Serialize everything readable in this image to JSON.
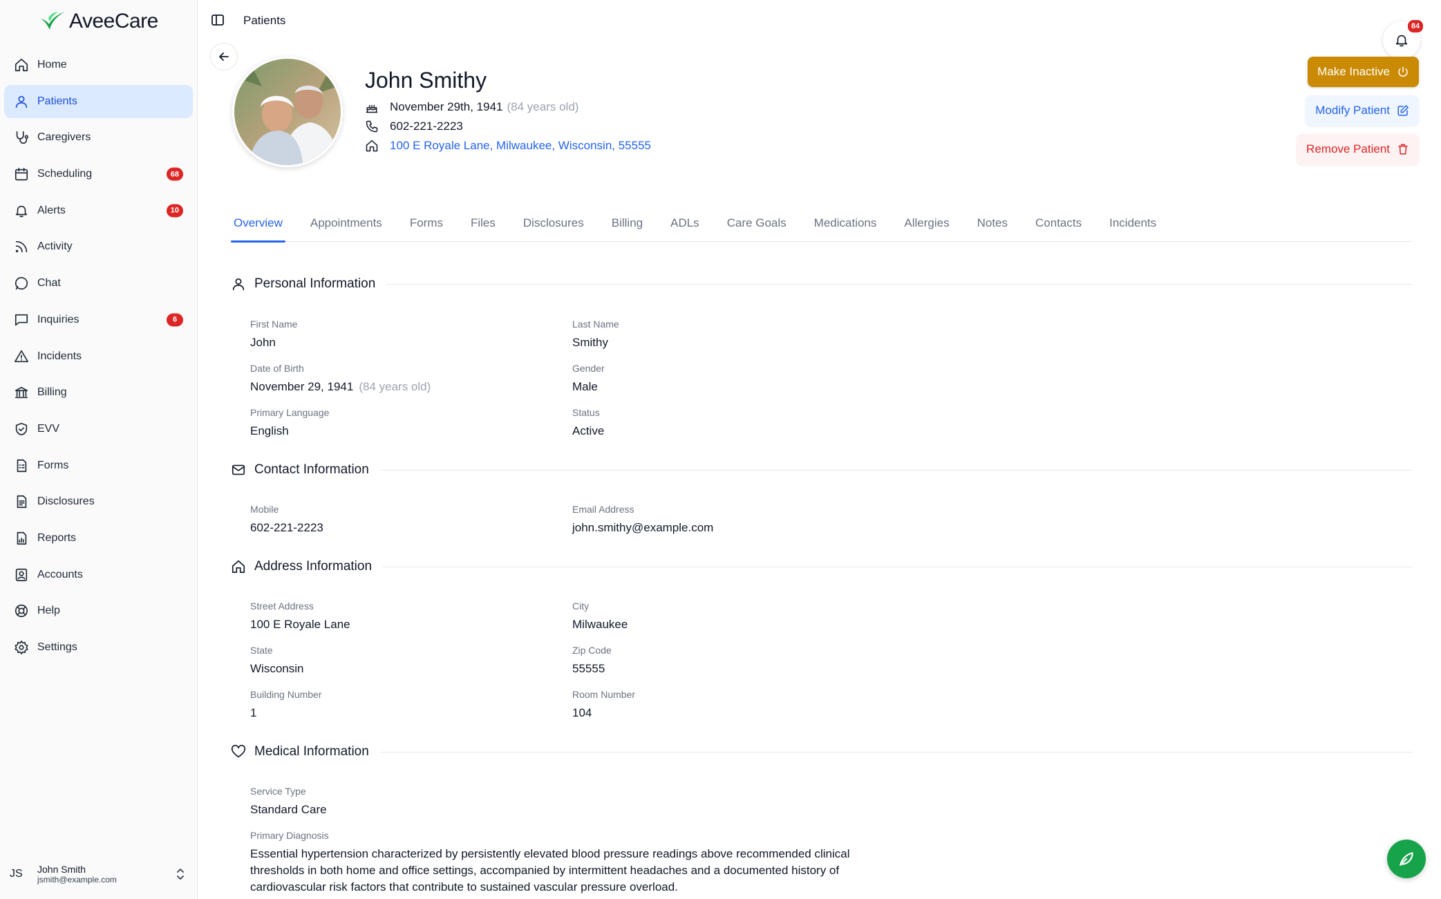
{
  "brand": {
    "name": "AveeCare",
    "color": "#16a34a"
  },
  "sidebar": {
    "items": [
      {
        "label": "Home",
        "icon": "home-icon"
      },
      {
        "label": "Patients",
        "icon": "user-icon",
        "active": true
      },
      {
        "label": "Caregivers",
        "icon": "stethoscope-icon"
      },
      {
        "label": "Scheduling",
        "icon": "calendar-icon",
        "badge": "68"
      },
      {
        "label": "Alerts",
        "icon": "bell-icon",
        "badge": "10"
      },
      {
        "label": "Activity",
        "icon": "rss-icon"
      },
      {
        "label": "Chat",
        "icon": "chat-bubble-icon"
      },
      {
        "label": "Inquiries",
        "icon": "message-square-icon",
        "badge": "6"
      },
      {
        "label": "Incidents",
        "icon": "warning-triangle-icon"
      },
      {
        "label": "Billing",
        "icon": "bank-icon"
      },
      {
        "label": "EVV",
        "icon": "shield-check-icon"
      },
      {
        "label": "Forms",
        "icon": "form-icon"
      },
      {
        "label": "Disclosures",
        "icon": "document-icon"
      },
      {
        "label": "Reports",
        "icon": "report-icon"
      },
      {
        "label": "Accounts",
        "icon": "contact-icon"
      },
      {
        "label": "Help",
        "icon": "lifebuoy-icon"
      },
      {
        "label": "Settings",
        "icon": "gear-icon"
      }
    ],
    "user": {
      "initials": "JS",
      "name": "John Smith",
      "email": "jsmith@example.com"
    }
  },
  "header": {
    "breadcrumb": "Patients",
    "notification_count": "84"
  },
  "patient": {
    "name": "John Smithy",
    "dob_long": "November 29th, 1941",
    "age": "(84 years old)",
    "phone": "602-221-2223",
    "address": "100 E Royale Lane, Milwaukee, Wisconsin, 55555"
  },
  "actions": {
    "make_inactive": "Make Inactive",
    "modify": "Modify Patient",
    "remove": "Remove Patient"
  },
  "tabs": [
    "Overview",
    "Appointments",
    "Forms",
    "Files",
    "Disclosures",
    "Billing",
    "ADLs",
    "Care Goals",
    "Medications",
    "Allergies",
    "Notes",
    "Contacts",
    "Incidents"
  ],
  "sections": {
    "personal": {
      "title": "Personal Information",
      "first_name_label": "First Name",
      "first_name": "John",
      "last_name_label": "Last Name",
      "last_name": "Smithy",
      "dob_label": "Date of Birth",
      "dob": "November 29, 1941",
      "dob_age": "(84 years old)",
      "gender_label": "Gender",
      "gender": "Male",
      "language_label": "Primary Language",
      "language": "English",
      "status_label": "Status",
      "status": "Active"
    },
    "contact": {
      "title": "Contact Information",
      "mobile_label": "Mobile",
      "mobile": "602-221-2223",
      "email_label": "Email Address",
      "email": "john.smithy@example.com"
    },
    "address": {
      "title": "Address Information",
      "street_label": "Street Address",
      "street": "100 E Royale Lane",
      "city_label": "City",
      "city": "Milwaukee",
      "state_label": "State",
      "state": "Wisconsin",
      "zip_label": "Zip Code",
      "zip": "55555",
      "building_label": "Building Number",
      "building": "1",
      "room_label": "Room Number",
      "room": "104"
    },
    "medical": {
      "title": "Medical Information",
      "service_label": "Service Type",
      "service": "Standard Care",
      "diagnosis_label": "Primary Diagnosis",
      "diagnosis_lines": [
        "Essential hypertension characterized by persistently elevated blood pressure readings above recommended clinical",
        "thresholds in both home and office settings, accompanied by intermittent headaches and a documented history of",
        "cardiovascular risk factors that contribute to sustained vascular pressure overload."
      ]
    }
  },
  "colors": {
    "accent": "#2563eb",
    "warning": "#ca8a04",
    "danger": "#dc2626",
    "active_nav_bg": "#dbeafe"
  }
}
